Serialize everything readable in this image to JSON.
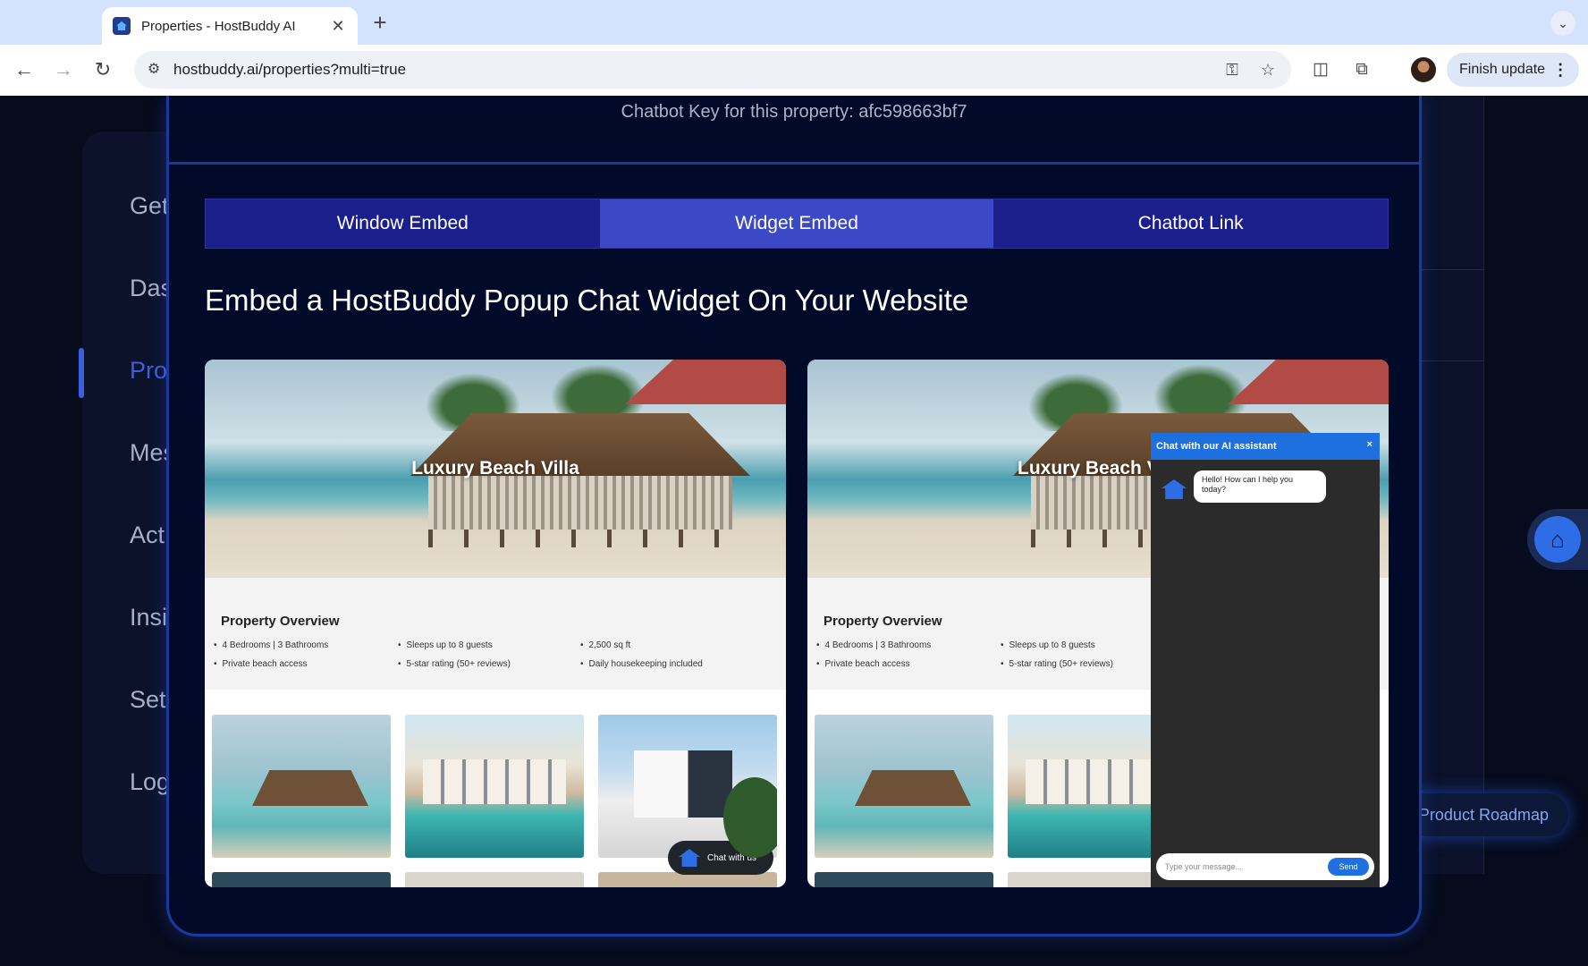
{
  "browser": {
    "tab_title": "Properties - HostBuddy AI",
    "url": "hostbuddy.ai/properties?multi=true",
    "finish_update_label": "Finish update"
  },
  "background": {
    "sidebar_items": [
      "Get",
      "Das",
      "Pro",
      "Mes",
      "Act",
      "Insi",
      "Set",
      "Log"
    ],
    "roadmap_label": "Product Roadmap"
  },
  "modal": {
    "chatbot_key_text": "Chatbot Key for this property: afc598663bf7",
    "tabs": [
      {
        "label": "Window Embed",
        "active": false
      },
      {
        "label": "Widget Embed",
        "active": true
      },
      {
        "label": "Chatbot Link",
        "active": false
      }
    ],
    "heading": "Embed a HostBuddy Popup Chat Widget On Your Website"
  },
  "preview": {
    "hero_title": "Luxury Beach Villa",
    "hero_title_cut": "Luxury Beach V",
    "overview_title": "Property Overview",
    "overview_items": [
      "4 Bedrooms | 3 Bathrooms",
      "Sleeps up to 8 guests",
      "2,500 sq ft",
      "Private beach access",
      "5-star rating (50+ reviews)",
      "Daily housekeeping included"
    ],
    "chat_launcher_label": "Chat with us"
  },
  "chat_widget": {
    "header": "Chat with our AI assistant",
    "close_glyph": "×",
    "greeting": "Hello! How can I help you today?",
    "input_placeholder": "Type your message...",
    "send_label": "Send"
  },
  "colors": {
    "modal_bg": "#020a2a",
    "tab_default": "#1a1f8c",
    "tab_active": "#3b49c6",
    "chat_accent": "#1e6fe0"
  }
}
